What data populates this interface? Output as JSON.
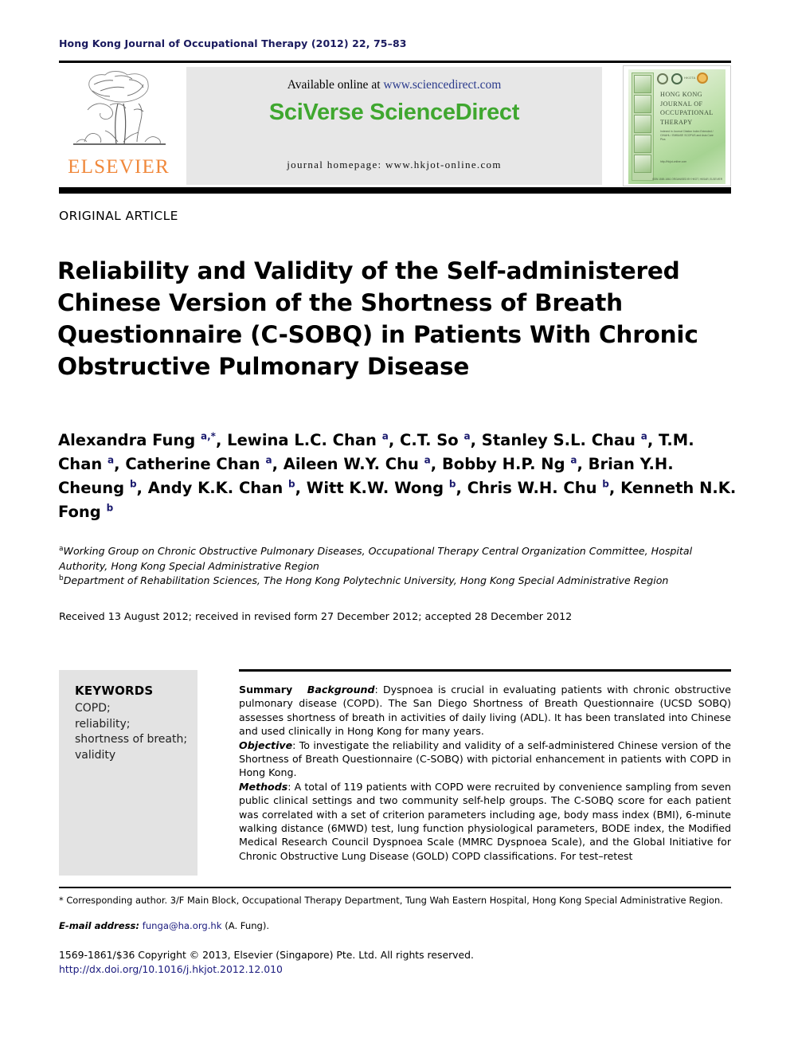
{
  "running_head": "Hong Kong Journal of Occupational Therapy (2012) 22, 75–83",
  "header": {
    "publisher_name": "ELSEVIER",
    "available_prefix": "Available online at ",
    "available_url": "www.sciencedirect.com",
    "sciverse_title": "SciVerse ScienceDirect",
    "journal_homepage": "journal homepage: www.hkjot-online.com",
    "cover": {
      "title": "HONG KONG JOURNAL OF OCCUPATIONAL THERAPY",
      "subtitle": "Indexed in Journal Citation Index Extended / CINAHL / EMBASE SCOPUS and Asia Care Plus",
      "url": "http://hkjot-online.com",
      "footer": "ISSN 1569-1861 ORGANISED BY HKOT, HKSAR, ELSEVIER"
    }
  },
  "article_type": "ORIGINAL ARTICLE",
  "title": "Reliability and Validity of the Self-administered Chinese Version of the Shortness of Breath Questionnaire (C-SOBQ) in Patients With Chronic Obstructive Pulmonary Disease",
  "authors_html": "Alexandra Fung <sup>a,*</sup>, Lewina L.C. Chan <sup>a</sup>, C.T. So <sup>a</sup>, Stanley S.L. Chau <sup>a</sup>, T.M. Chan <sup>a</sup>, Catherine Chan <sup>a</sup>, Aileen W.Y. Chu <sup>a</sup>, Bobby H.P. Ng <sup>a</sup>, Brian Y.H. Cheung <sup>b</sup>, Andy K.K. Chan <sup>b</sup>, Witt K.W. Wong <sup>b</sup>, Chris W.H. Chu <sup>b</sup>, Kenneth N.K. Fong <sup>b</sup>",
  "affiliations": [
    {
      "marker": "a",
      "text": "Working Group on Chronic Obstructive Pulmonary Diseases, Occupational Therapy Central Organization Committee, Hospital Authority, Hong Kong Special Administrative Region"
    },
    {
      "marker": "b",
      "text": "Department of Rehabilitation Sciences, The Hong Kong Polytechnic University, Hong Kong Special Administrative Region"
    }
  ],
  "received": "Received 13 August 2012; received in revised form 27 December 2012; accepted 28 December 2012",
  "keywords": {
    "heading": "KEYWORDS",
    "items": [
      "COPD;",
      "reliability;",
      "shortness of breath;",
      "validity"
    ]
  },
  "summary": {
    "label": "Summary",
    "sections": [
      {
        "heading": "Background",
        "text": ": Dyspnoea is crucial in evaluating patients with chronic obstructive pulmonary disease (COPD). The San Diego Shortness of Breath Questionnaire (UCSD SOBQ) assesses shortness of breath in activities of daily living (ADL). It has been translated into Chinese and used clinically in Hong Kong for many years."
      },
      {
        "heading": "Objective",
        "text": ": To investigate the reliability and validity of a self-administered Chinese version of the Shortness of Breath Questionnaire (C-SOBQ) with pictorial enhancement in patients with COPD in Hong Kong."
      },
      {
        "heading": "Methods",
        "text": ": A total of 119 patients with COPD were recruited by convenience sampling from seven public clinical settings and two community self-help groups. The C-SOBQ score for each patient was correlated with a set of criterion parameters including age, body mass index (BMI), 6-minute walking distance (6MWD) test, lung function physiological parameters, BODE index, the Modified Medical Research Council Dyspnoea Scale (MMRC Dyspnoea Scale), and the Global Initiative for Chronic Obstructive Lung Disease (GOLD) COPD classifications. For test–retest"
      }
    ]
  },
  "footnotes": {
    "corresponding": "* Corresponding author. 3/F Main Block, Occupational Therapy Department, Tung Wah Eastern Hospital, Hong Kong Special Administrative Region.",
    "email_label": "E-mail address:",
    "email_address": "funga@ha.org.hk",
    "email_suffix": "(A. Fung).",
    "copyright": "1569-1861/$36 Copyright © 2013, Elsevier (Singapore) Pte. Ltd. All rights reserved.",
    "doi": "http://dx.doi.org/10.1016/j.hkjot.2012.12.010"
  },
  "colors": {
    "running_head": "#1a1a5e",
    "sciencedirect_green": "#3FA72F",
    "elsevier_orange": "#F0883B",
    "link_blue": "#1a1a7e",
    "header_grey": "#e7e7e7",
    "keyword_grey": "#e3e3e3"
  }
}
